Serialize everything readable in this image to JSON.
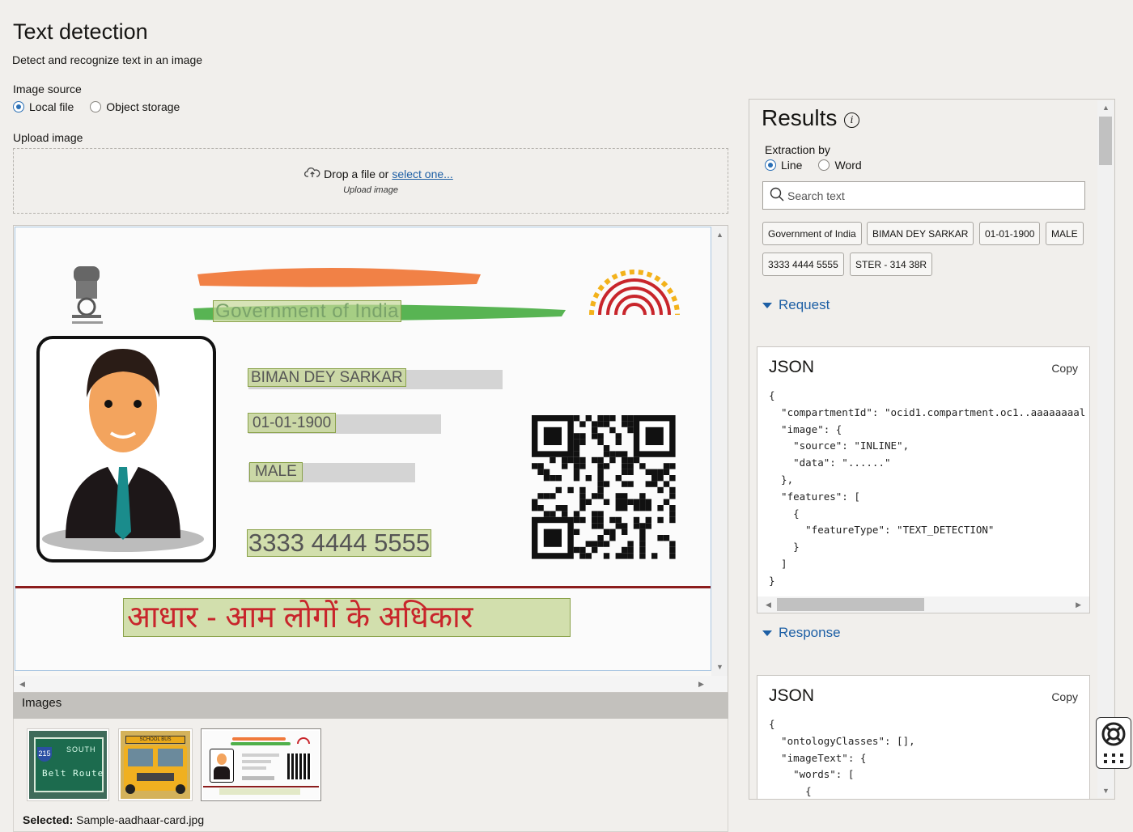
{
  "header": {
    "title": "Text detection",
    "subtitle": "Detect and recognize text in an image"
  },
  "image_source": {
    "label": "Image source",
    "options": [
      "Local file",
      "Object storage"
    ],
    "selected": "Local file"
  },
  "upload": {
    "label": "Upload image",
    "drop_text": "Drop a file or",
    "select_link": "select one...",
    "sub_label": "Upload image"
  },
  "card": {
    "header_text": "Government of India",
    "name": "BIMAN DEY SARKAR",
    "dob": "01-01-1900",
    "gender": "MALE",
    "number": "3333 4444 5555",
    "hindi_tagline": "आधार - आम लोगों के अधिकार"
  },
  "images_section": {
    "title": "Images",
    "thumbnails": [
      {
        "name": "belt-route-sign",
        "text_top": "SOUTH",
        "text_bottom": "Belt Route",
        "badge": "215"
      },
      {
        "name": "school-bus",
        "text_top": "SCHOOL BUS"
      },
      {
        "name": "aadhaar-card",
        "selected": true
      }
    ],
    "selected_label": "Selected:",
    "selected_file": "Sample-aadhaar-card.jpg"
  },
  "results": {
    "title": "Results",
    "extraction_label": "Extraction by",
    "extraction_options": [
      "Line",
      "Word"
    ],
    "extraction_selected": "Line",
    "search_placeholder": "Search text",
    "chips": [
      "Government of India",
      "BIMAN DEY SARKAR",
      "01-01-1900",
      "MALE",
      "3333 4444 5555",
      "STER - 314 38R"
    ],
    "request": {
      "label": "Request",
      "json_title": "JSON",
      "copy_label": "Copy",
      "code": "{\n  \"compartmentId\": \"ocid1.compartment.oc1..aaaaaaaal\n  \"image\": {\n    \"source\": \"INLINE\",\n    \"data\": \"......\"\n  },\n  \"features\": [\n    {\n      \"featureType\": \"TEXT_DETECTION\"\n    }\n  ]\n}"
    },
    "response": {
      "label": "Response",
      "json_title": "JSON",
      "copy_label": "Copy",
      "code": "{\n  \"ontologyClasses\": [],\n  \"imageText\": {\n    \"words\": [\n      {"
    }
  },
  "colors": {
    "link": "#1d5fa5",
    "highlight_fill": "#c8d89a",
    "highlight_border": "#8aa24a",
    "saffron": "#f07a3c",
    "green": "#4fb04a"
  }
}
